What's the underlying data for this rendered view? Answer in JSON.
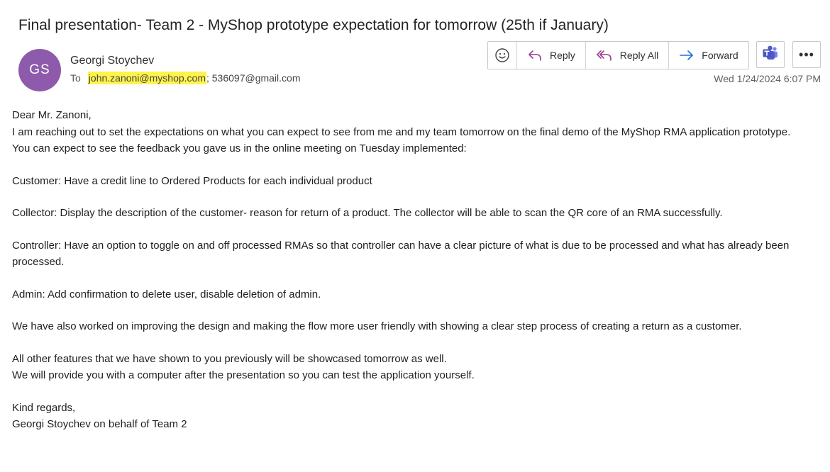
{
  "email": {
    "subject": "Final presentation- Team 2 - MyShop prototype expectation for tomorrow (25th if January)",
    "sender": {
      "initials": "GS",
      "name": "Georgi Stoychev",
      "avatar_color": "#8e5aab"
    },
    "to_label": "To",
    "recipients": {
      "highlighted": "john.zanoni@myshop.com",
      "others": "; 536097@gmail.com"
    },
    "timestamp": "Wed 1/24/2024 6:07 PM"
  },
  "toolbar": {
    "emoji_icon": "smiley-icon",
    "reply_label": "Reply",
    "reply_all_label": "Reply All",
    "forward_label": "Forward",
    "teams_icon": "teams-icon",
    "more_icon": "more-icon",
    "more_glyph": "•••"
  },
  "body": {
    "greeting": "Dear Mr. Zanoni,",
    "intro1": "I am reaching out to set the expectations on what you can expect to see from me and my team tomorrow on the final demo of the MyShop RMA application prototype.",
    "intro2": "You can expect to see the feedback you gave us in the online meeting on Tuesday implemented:",
    "customer": "Customer: Have a credit line to Ordered Products for each individual product",
    "collector": "Collector:  Display the description of the customer- reason for return of a product. The collector will be able to scan the QR core of an RMA successfully.",
    "controller": "Controller: Have an option to toggle on and off processed RMAs so that controller can have a clear picture of what is due to be processed and what has already been processed.",
    "admin": "Admin: Add confirmation to delete user, disable deletion of admin.",
    "design": "We have also worked on improving the design and making the flow more user friendly with showing a clear step process of creating a return as a customer.",
    "other1": "All other features that we have shown to you previously will be showcased tomorrow as well.",
    "other2": "We will provide you with a computer after the presentation so you can test the application yourself.",
    "closing": "Kind regards,",
    "signature": "Georgi Stoychev on behalf of Team 2"
  },
  "colors": {
    "reply_accent": "#9b3f8f",
    "forward_accent": "#1f6fd1",
    "highlight": "#fff34d"
  }
}
